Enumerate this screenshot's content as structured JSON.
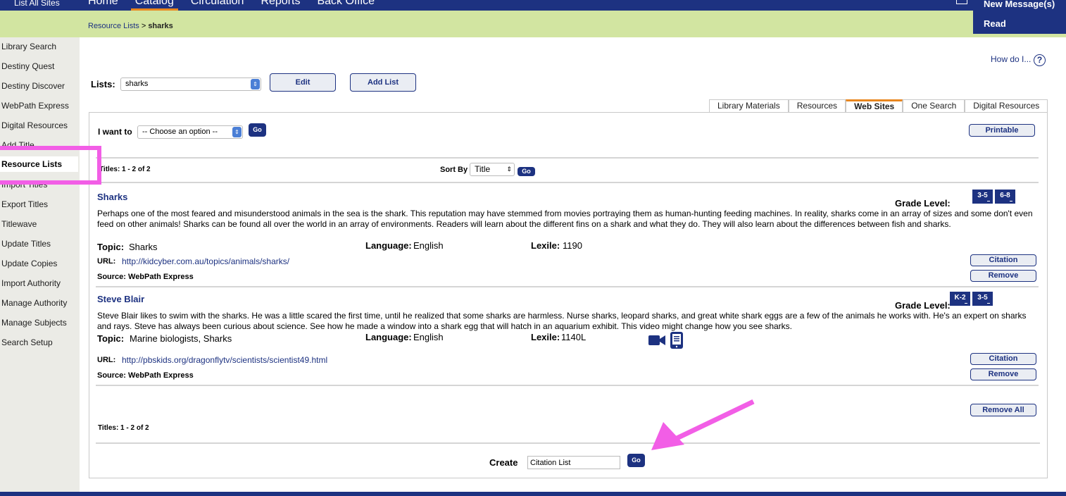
{
  "topbar": {
    "site_link": "List All Sites",
    "nav": [
      "Home",
      "Catalog",
      "Circulation",
      "Reports",
      "Back Office"
    ],
    "active_nav": "Catalog",
    "messages": "New Message(s)",
    "read": "Read"
  },
  "breadcrumb": {
    "parent": "Resource Lists",
    "separator": " > ",
    "current": "sharks"
  },
  "sidebar": {
    "items": [
      "Library Search",
      "Destiny Quest",
      "Destiny Discover",
      "WebPath Express",
      "Digital Resources",
      "Add Title",
      "Resource Lists",
      "Import Titles",
      "Export Titles",
      "Titlewave",
      "Update Titles",
      "Update Copies",
      "Import Authority",
      "Manage Authority",
      "Manage Subjects",
      "Search Setup"
    ],
    "active": "Resource Lists"
  },
  "help": {
    "label": "How do I...",
    "icon": "?"
  },
  "lists": {
    "label": "Lists:",
    "selected": "sharks",
    "edit": "Edit",
    "add_list": "Add List"
  },
  "tabs": [
    "Library Materials",
    "Resources",
    "Web Sites",
    "One Search",
    "Digital Resources"
  ],
  "active_tab": "Web Sites",
  "toolbar": {
    "i_want_to": "I want to",
    "choose_option": "-- Choose an option --",
    "go": "Go",
    "printable": "Printable",
    "titles_count": "Titles: 1 - 2 of 2",
    "sort_by": "Sort By",
    "sort_value": "Title"
  },
  "items": [
    {
      "title": "Sharks",
      "grade_label": "Grade Level:",
      "grades": [
        "3-5",
        "6-8"
      ],
      "description": "Perhaps one of the most feared and misunderstood animals in the sea is the shark. This reputation may have stemmed from movies portraying them as human-hunting feeding machines. In reality, sharks come in an array of sizes and some don't even feed on other animals! Sharks can be found all over the world in an array of environments. Readers will learn about the different fins on a shark and what they do. They will also learn about the differences between fish and sharks.",
      "topic_label": "Topic:",
      "topic": "Sharks",
      "language_label": "Language:",
      "language": "English",
      "lexile_label": "Lexile:",
      "lexile": "1190",
      "url_label": "URL:",
      "url": "http://kidcyber.com.au/topics/animals/sharks/",
      "source": "Source: WebPath Express",
      "citation": "Citation",
      "remove": "Remove"
    },
    {
      "title": "Steve Blair",
      "grade_label": "Grade Level:",
      "grades": [
        "K-2",
        "3-5"
      ],
      "description": "Steve Blair likes to swim with the sharks. He was a little scared the first time, until he realized that some sharks are harmless. Nurse sharks, leopard sharks, and great white shark eggs are a few of the animals he works with. He's an expert on sharks and rays. Steve has always been curious about science. See how he made a window into a shark egg that will hatch in an aquarium exhibit. This video might change how you see sharks.",
      "topic_label": "Topic:",
      "topic": "Marine biologists, Sharks",
      "language_label": "Language:",
      "language": "English",
      "lexile_label": "Lexile:",
      "lexile": "1140L",
      "url_label": "URL:",
      "url": "http://pbskids.org/dragonflytv/scientists/scientist49.html",
      "source": "Source: WebPath Express",
      "citation": "Citation",
      "remove": "Remove"
    }
  ],
  "bottom": {
    "remove_all": "Remove All",
    "titles_count": "Titles: 1 - 2 of 2",
    "create_label": "Create",
    "create_value": "Citation List",
    "go": "Go"
  },
  "colors": {
    "navy": "#1d3281",
    "green_bar": "#d2e5a1",
    "accent_orange": "#e8861f",
    "annotation_pink": "#f25ee6"
  }
}
